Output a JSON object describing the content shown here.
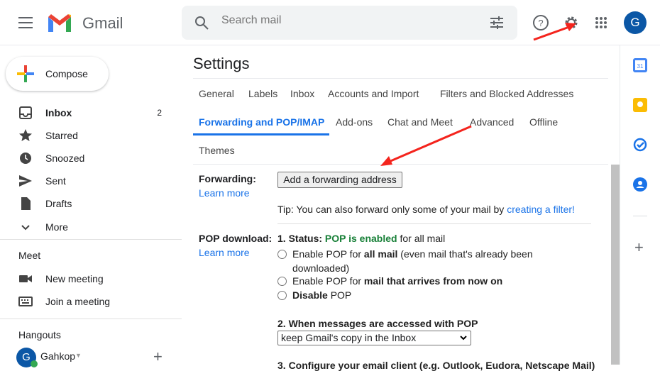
{
  "header": {
    "app_name": "Gmail",
    "search_placeholder": "Search mail",
    "avatar_letter": "G"
  },
  "sidebar": {
    "compose": "Compose",
    "items": [
      {
        "label": "Inbox",
        "count": "2"
      },
      {
        "label": "Starred"
      },
      {
        "label": "Snoozed"
      },
      {
        "label": "Sent"
      },
      {
        "label": "Drafts"
      },
      {
        "label": "More"
      }
    ],
    "meet_title": "Meet",
    "meet_items": [
      "New meeting",
      "Join a meeting"
    ],
    "hangouts_title": "Hangouts",
    "hangouts_user": "Gahkop",
    "hangouts_avatar": "G"
  },
  "settings": {
    "title": "Settings",
    "tabs": [
      "General",
      "Labels",
      "Inbox",
      "Accounts and Import",
      "Filters and Blocked Addresses",
      "Forwarding and POP/IMAP",
      "Add-ons",
      "Chat and Meet",
      "Advanced",
      "Offline",
      "Themes"
    ],
    "active_tab": "Forwarding and POP/IMAP",
    "forwarding": {
      "label": "Forwarding:",
      "learn_more": "Learn more",
      "button": "Add a forwarding address",
      "tip": "Tip: You can also forward only some of your mail by ",
      "tip_link": "creating a filter!"
    },
    "pop": {
      "label": "POP download:",
      "learn_more": "Learn more",
      "status_prefix": "1. Status: ",
      "status_value": "POP is enabled",
      "status_suffix": " for all mail",
      "opt1_a": "Enable POP for ",
      "opt1_b": "all mail",
      "opt1_c": " (even mail that's already been downloaded)",
      "opt2_a": "Enable POP for ",
      "opt2_b": "mail that arrives from now on",
      "opt3_a": "Disable",
      "opt3_b": " POP",
      "step2": "2. When messages are accessed with POP",
      "step2_value": "keep Gmail's copy in the Inbox",
      "step3": "3. Configure your email client (e.g. Outlook, Eudora, Netscape Mail)"
    }
  },
  "colors": {
    "accent": "#1a73e8",
    "enabled": "#188038",
    "arrow": "#f4241d"
  }
}
